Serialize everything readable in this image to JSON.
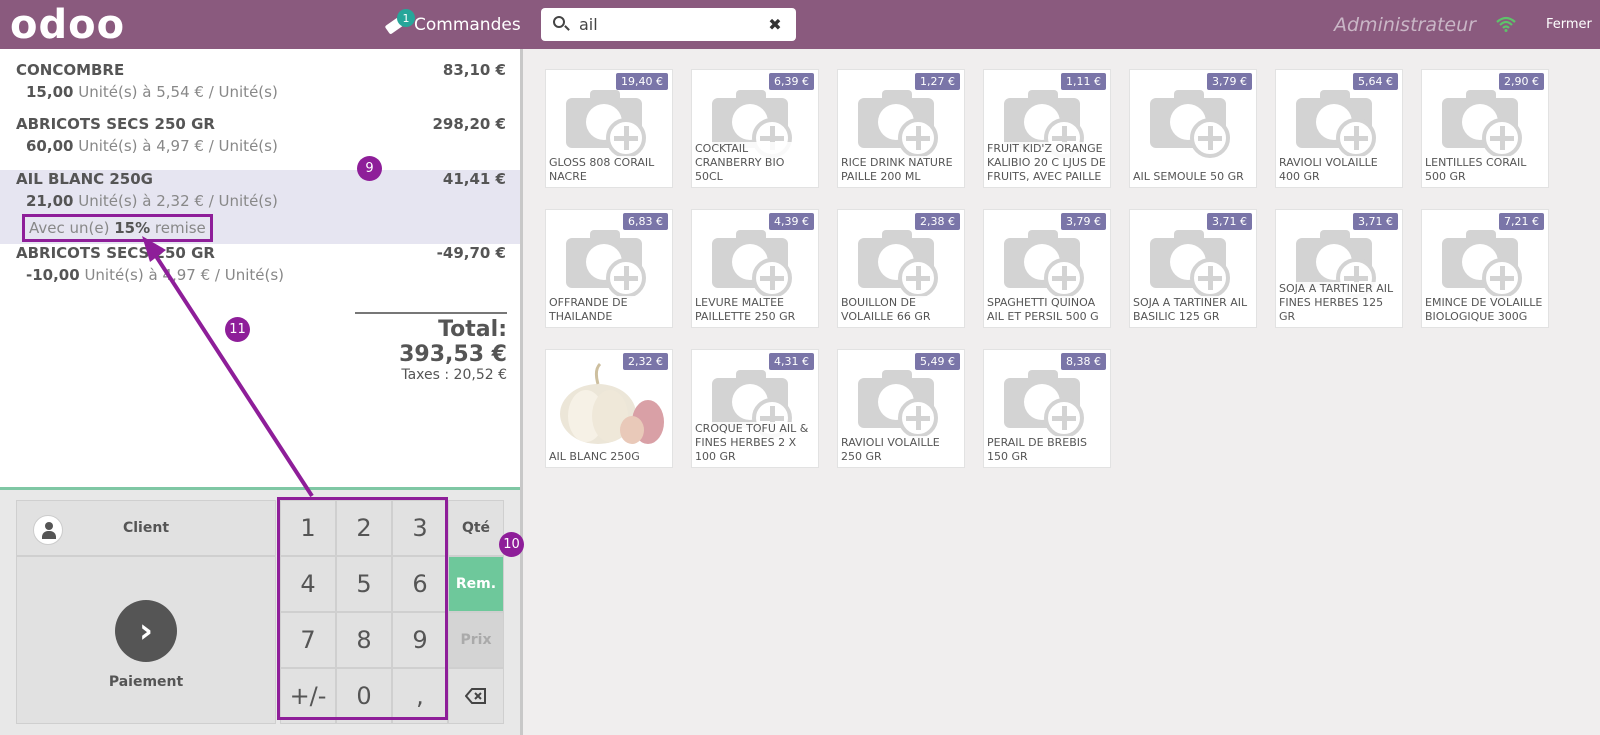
{
  "header": {
    "logo": "odoo",
    "orders_label": "Commandes",
    "orders_count": "1",
    "search_value": "ail",
    "user": "Administrateur",
    "close_label": "Fermer"
  },
  "orderlines": [
    {
      "name": "CONCOMBRE",
      "total": "83,10 €",
      "qty": "15,00",
      "info": " Unité(s) à 5,54 € / Unité(s)"
    },
    {
      "name": "ABRICOTS SECS 250 GR",
      "total": "298,20 €",
      "qty": "60,00",
      "info": " Unité(s) à 4,97 € / Unité(s)"
    },
    {
      "name": "AIL BLANC 250G",
      "total": "41,41 €",
      "qty": "21,00",
      "info": " Unité(s) à 2,32 € / Unité(s)",
      "discount_pre": "Avec un(e) ",
      "discount_value": "15%",
      "discount_post": " remise"
    },
    {
      "name": "ABRICOTS SECS 250 GR",
      "total": "-49,70 €",
      "qty": "-10,00",
      "info": " Unité(s) à 4,97 € / Unité(s)"
    }
  ],
  "totals": {
    "total": "Total: 393,53 €",
    "taxes": "Taxes : 20,52 €"
  },
  "actionpad": {
    "client_label": "Client",
    "payment_label": "Paiement"
  },
  "numpad": {
    "keys": [
      "1",
      "2",
      "3",
      "4",
      "5",
      "6",
      "7",
      "8",
      "9",
      "+/-",
      "0",
      ","
    ],
    "modes": [
      "Qté",
      "Rem.",
      "Prix"
    ],
    "active_mode": "Rem."
  },
  "products": [
    {
      "name": "GLOSS 808 CORAIL NACRE",
      "price": "19,40 €"
    },
    {
      "name": "COCKTAIL CRANBERRY BIO 50CL",
      "price": "6,39 €"
    },
    {
      "name": "RICE DRINK NATURE PAILLE 200 ML",
      "price": "1,27 €"
    },
    {
      "name": "FRUIT KID'Z ORANGE KALIBIO 20 C LJUS DE FRUITS, AVEC PAILLE",
      "price": "1,11 €"
    },
    {
      "name": "AIL SEMOULE 50 GR",
      "price": "3,79 €"
    },
    {
      "name": "RAVIOLI VOLAILLE 400 GR",
      "price": "5,64 €"
    },
    {
      "name": "LENTILLES CORAIL 500 GR",
      "price": "2,90 €"
    },
    {
      "name": "OFFRANDE DE THAILANDE",
      "price": "6,83 €"
    },
    {
      "name": "LEVURE MALTEE PAILLETTE 250 GR",
      "price": "4,39 €"
    },
    {
      "name": "BOUILLON DE VOLAILLE 66 GR",
      "price": "2,38 €"
    },
    {
      "name": "SPAGHETTI QUINOA AIL ET PERSIL 500 G",
      "price": "3,79 €"
    },
    {
      "name": "SOJA A TARTINER AIL BASILIC 125 GR",
      "price": "3,71 €"
    },
    {
      "name": "SOJA A TARTINER AIL FINES HERBES 125 GR",
      "price": "3,71 €"
    },
    {
      "name": "EMINCE DE VOLAILLE BIOLOGIQUE 300G",
      "price": "7,21 €"
    },
    {
      "name": "AIL BLANC 250G",
      "price": "2,32 €"
    },
    {
      "name": "CROQUE TOFU AIL & FINES HERBES 2 X 100 GR",
      "price": "4,31 €"
    },
    {
      "name": "RAVIOLI VOLAILLE 250 GR",
      "price": "5,49 €"
    },
    {
      "name": "PERAIL DE BREBIS 150 GR",
      "price": "8,38 €"
    }
  ],
  "annotations": [
    "9",
    "10",
    "11"
  ],
  "colors": {
    "topbar": "#8a5a7e",
    "accent": "#8e1e99",
    "active_mode": "#6ec89b",
    "price_badge": "#7a75a8",
    "orders_badge": "#26a69a"
  }
}
